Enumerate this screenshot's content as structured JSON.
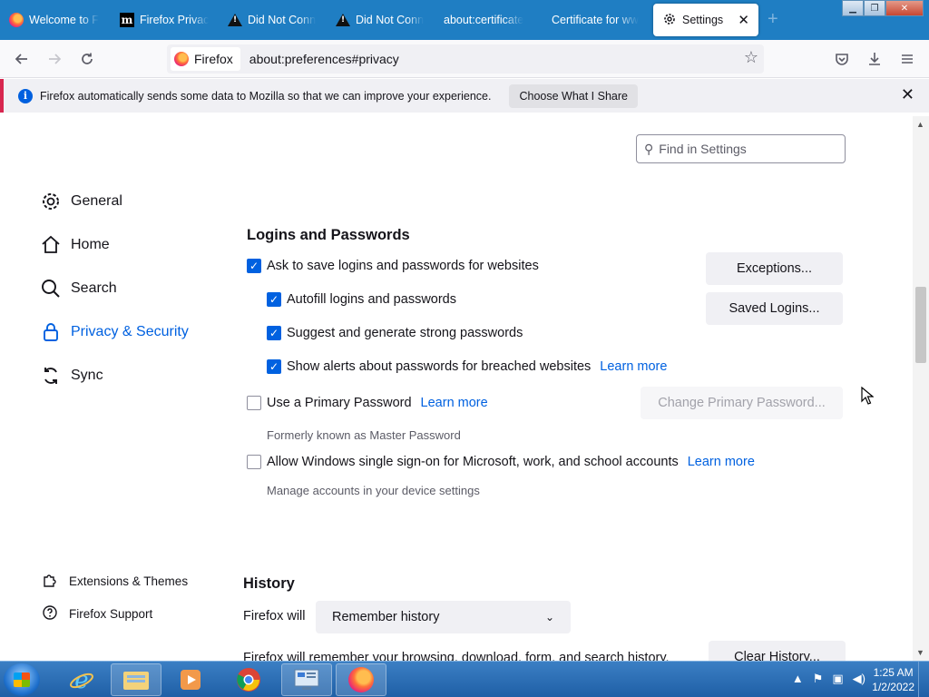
{
  "window": {
    "tabs": [
      {
        "label": "Welcome to F",
        "icon": "firefox-icon"
      },
      {
        "label": "Firefox Privac",
        "icon": "mozilla-m-icon"
      },
      {
        "label": "Did Not Conn",
        "icon": "warning-icon"
      },
      {
        "label": "Did Not Conn",
        "icon": "warning-icon"
      },
      {
        "label": "about:certificate",
        "icon": ""
      },
      {
        "label": "Certificate for ww",
        "icon": ""
      },
      {
        "label": "Settings",
        "icon": "gear-icon",
        "active": true
      }
    ],
    "controls": {
      "minimize": "▁",
      "restore": "❐",
      "close": "✕"
    }
  },
  "navbar": {
    "identity_label": "Firefox",
    "url": "about:preferences#privacy"
  },
  "notification": {
    "text": "Firefox automatically sends some data to Mozilla so that we can improve your experience.",
    "button": "Choose What I Share"
  },
  "search": {
    "placeholder": "Find in Settings"
  },
  "sidebar": {
    "items": [
      {
        "label": "General",
        "icon": "gear-icon"
      },
      {
        "label": "Home",
        "icon": "home-icon"
      },
      {
        "label": "Search",
        "icon": "search-icon"
      },
      {
        "label": "Privacy & Security",
        "icon": "lock-icon",
        "active": true
      },
      {
        "label": "Sync",
        "icon": "sync-icon"
      }
    ],
    "footer": [
      {
        "label": "Extensions & Themes",
        "icon": "puzzle-icon"
      },
      {
        "label": "Firefox Support",
        "icon": "help-icon"
      }
    ]
  },
  "logins": {
    "title": "Logins and Passwords",
    "ask_save": {
      "label": "Ask to save logins and passwords for websites",
      "checked": true
    },
    "autofill": {
      "label": "Autofill logins and passwords",
      "checked": true
    },
    "suggest": {
      "label": "Suggest and generate strong passwords",
      "checked": true
    },
    "alerts": {
      "label": "Show alerts about passwords for breached websites",
      "checked": true,
      "link": "Learn more"
    },
    "primary_password": {
      "label": "Use a Primary Password",
      "checked": false,
      "link": "Learn more",
      "hint": "Formerly known as Master Password"
    },
    "windows_sso": {
      "label": "Allow Windows single sign-on for Microsoft, work, and school accounts",
      "checked": false,
      "link": "Learn more",
      "hint": "Manage accounts in your device settings"
    },
    "buttons": {
      "exceptions": "Exceptions...",
      "saved_logins": "Saved Logins...",
      "change_primary": "Change Primary Password..."
    }
  },
  "history": {
    "title": "History",
    "will_label": "Firefox will",
    "mode": "Remember history",
    "description": "Firefox will remember your browsing, download, form, and search history.",
    "clear_button": "Clear History..."
  },
  "taskbar": {
    "apps": [
      "internet-explorer-icon",
      "file-explorer-icon",
      "media-player-icon",
      "chrome-icon",
      "control-panel-icon",
      "firefox-icon"
    ],
    "clock_time": "1:25 AM",
    "clock_date": "1/2/2022"
  },
  "colors": {
    "accent": "#0061e0",
    "tabbar": "#1f7ec3",
    "notice_bar": "#d7264f"
  }
}
